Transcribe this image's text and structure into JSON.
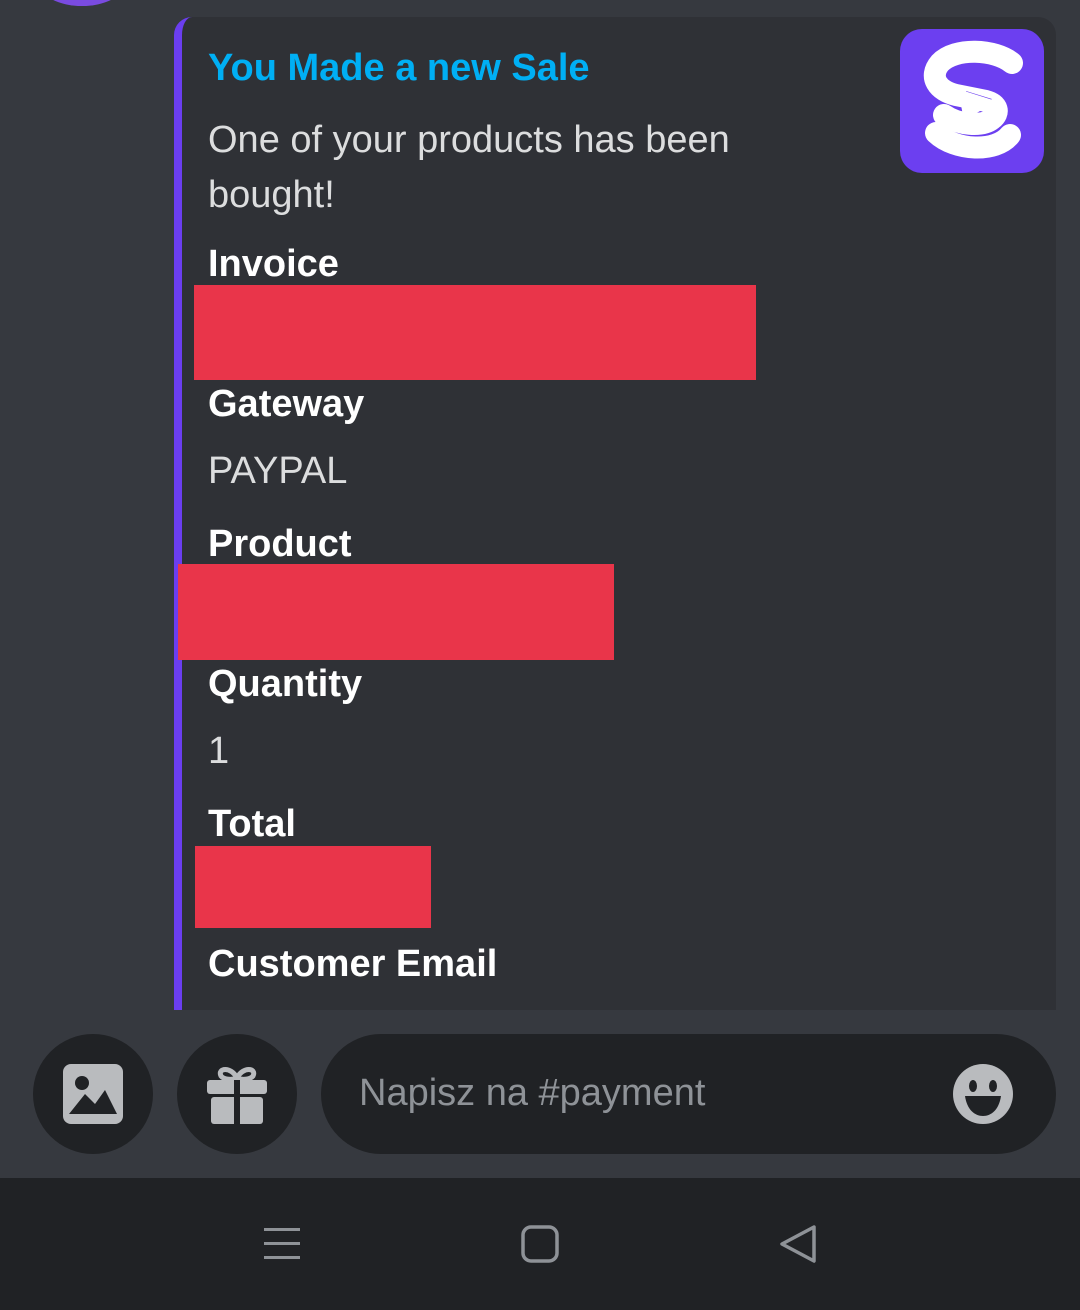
{
  "embed": {
    "title": "You Made a new Sale",
    "description": "One of your products has been bought!",
    "accent_color": "#6b3ef0",
    "title_color": "#00aff4",
    "fields": [
      {
        "name": "Invoice",
        "value": ""
      },
      {
        "name": "Gateway",
        "value": "PAYPAL"
      },
      {
        "name": "Product",
        "value": ""
      },
      {
        "name": "Quantity",
        "value": "1"
      },
      {
        "name": "Total",
        "value": ""
      },
      {
        "name": "Customer Email",
        "value": ""
      }
    ],
    "thumbnail_icon": "sellix-logo-icon",
    "redaction_color": "#e9354a"
  },
  "composer": {
    "placeholder": "Napisz na #payment",
    "image_button_icon": "image-icon",
    "gift_button_icon": "gift-icon",
    "emoji_button_icon": "emoji-smile-icon"
  },
  "navbar": {
    "icons": [
      "menu-icon",
      "home-square-icon",
      "back-triangle-icon"
    ]
  }
}
